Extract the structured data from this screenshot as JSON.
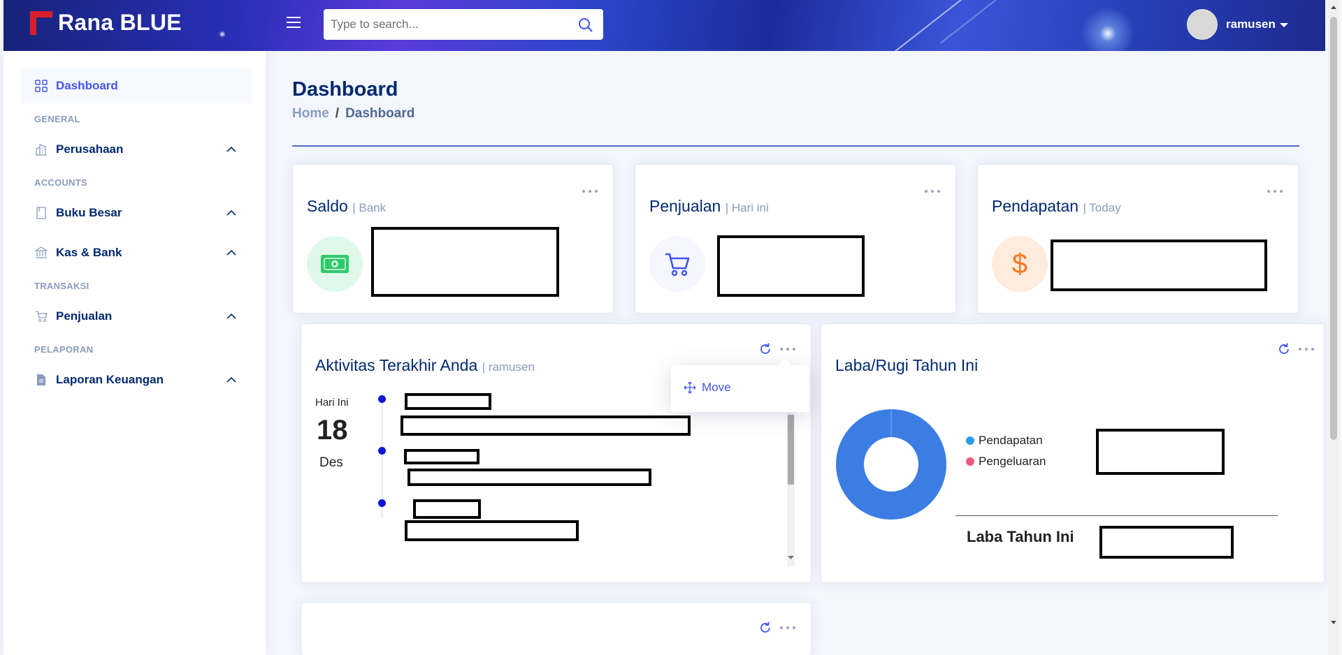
{
  "app": {
    "title": "Rana BLUE",
    "user": "ramusen"
  },
  "search": {
    "placeholder": "Type to search..."
  },
  "sidebar": {
    "items": [
      {
        "label": "Dashboard"
      },
      {
        "heading": "GENERAL"
      },
      {
        "label": "Perusahaan"
      },
      {
        "heading": "ACCOUNTS"
      },
      {
        "label": "Buku Besar"
      },
      {
        "label": "Kas & Bank"
      },
      {
        "heading": "TRANSAKSI"
      },
      {
        "label": "Penjualan"
      },
      {
        "heading": "PELAPORAN"
      },
      {
        "label": "Laporan Keuangan"
      }
    ]
  },
  "page": {
    "title": "Dashboard",
    "breadcrumb": {
      "home": "Home",
      "separator": "/",
      "current": "Dashboard"
    }
  },
  "cards": {
    "saldo": {
      "title": "Saldo",
      "sub": "| Bank"
    },
    "penjualan": {
      "title": "Penjualan",
      "sub": "| Hari ini"
    },
    "pendapatan": {
      "title": "Pendapatan",
      "sub": "| Today",
      "symbol": "$"
    }
  },
  "activity": {
    "title": "Aktivitas Terakhir Anda",
    "sub": "| ramusen",
    "date_label": "Hari Ini",
    "day": "18",
    "month": "Des"
  },
  "dropdown": {
    "move_label": "Move"
  },
  "laba_rugi": {
    "title": "Laba/Rugi Tahun Ini",
    "legend": [
      {
        "name": "Pendapatan",
        "color": "#2e9be6"
      },
      {
        "name": "Pengeluaran",
        "color": "#f0597a"
      }
    ],
    "donut_color": "#3b7de3",
    "laba_label": "Laba Tahun Ini"
  },
  "colors": {
    "accent": "#4154f1",
    "navy": "#012970",
    "muted": "#899bbd"
  }
}
